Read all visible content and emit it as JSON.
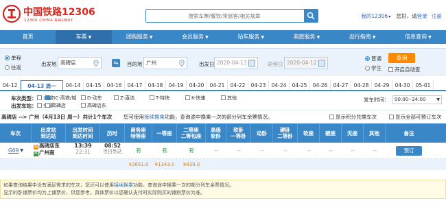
{
  "header": {
    "logo_cn": "中国铁路12306",
    "logo_en": "12306 CHINA RAILWAY",
    "search_placeholder": "搜索车票/餐饮/常旅客/相关规章",
    "my_account": "我的12306",
    "greeting": "您好，请",
    "login": "登录",
    "register": "注册"
  },
  "nav": [
    {
      "label": "首页",
      "chevron": false
    },
    {
      "label": "车票",
      "chevron": true
    },
    {
      "label": "团购服务",
      "chevron": true
    },
    {
      "label": "会员服务",
      "chevron": true
    },
    {
      "label": "站车服务",
      "chevron": true
    },
    {
      "label": "商旅服务",
      "chevron": true
    },
    {
      "label": "出行指南",
      "chevron": true
    },
    {
      "label": "信息查询",
      "chevron": true
    }
  ],
  "query": {
    "one_way": "单程",
    "round_trip": "往返",
    "from_label": "出发地",
    "from_value": "高碑店",
    "to_label": "目的地",
    "to_value": "广州",
    "depart_label": "出发日",
    "depart_value": "2020-04-13",
    "return_label": "返程日",
    "return_value": "2020-04-12",
    "search_button": "查询",
    "normal": "普通",
    "student": "学生",
    "auto_query": "开启自动查"
  },
  "dates": [
    "04-12",
    "04-13 周一",
    "04-14",
    "04-15",
    "04-16",
    "04-17",
    "04-18",
    "04-19",
    "04-20",
    "04-21",
    "04-22",
    "04-23",
    "04-24",
    "04-25",
    "04-26",
    "04-27",
    "04-28",
    "04-29",
    "04-30",
    "05-01"
  ],
  "filters": {
    "train_type_label": "车次类型：",
    "types": [
      "全部",
      "GC-高铁/城",
      "D-动车",
      "Z-直达",
      "T-特快",
      "K-快速",
      "其他"
    ],
    "station_label": "出发车站：",
    "stations": [
      "全部",
      "高碑店",
      "高碑店东"
    ],
    "depart_time_label": "发车时间：",
    "depart_time_value": "00:00--24:00"
  },
  "route": {
    "summary": "高碑店 --> 广州（4月13日 周一）共计1个车次",
    "tip_prefix": "您可使用",
    "tip_link": "接续换乘",
    "tip_suffix": "功能，查询途中换乘一次的部分列车余票情况。",
    "show_points": "显示积分兑换车次",
    "show_all": "显示全部可预订车次"
  },
  "table": {
    "headers": [
      "车次",
      "出发站\n到达站",
      "出发时间\n到达时间",
      "历时",
      "商务座\n特等座",
      "一等座",
      "二等座\n二等包座",
      "高级\n软卧",
      "软卧\n一等卧",
      "动卧",
      "硬卧\n二等卧",
      "软座",
      "硬座",
      "无座",
      "其他",
      "备注"
    ],
    "row": {
      "train": "G69",
      "from_station": "高碑店东",
      "to_station": "广州南",
      "depart_time": "13:39",
      "arrive_time": "22:31",
      "duration": "08:52",
      "arrive_day": "当日到达",
      "business": "有",
      "first": "有",
      "second": "有",
      "others": [
        "--",
        "--",
        "--",
        "--",
        "--",
        "--",
        "--",
        "--"
      ],
      "book": "预订"
    },
    "prices": [
      "¥2651.0",
      "¥1343.0",
      "¥839.0"
    ]
  },
  "notice": {
    "line1_prefix": "如果查询结果中没有满足需求的车次，您还可以使用",
    "line1_link": "接续换乘",
    "line1_suffix": "功能，查询途中换乘一次的部分列车余票情况。",
    "line2": "显示的卧铺票价均为上铺票价，供您参考。具体票价以您确认支付时实际购买的铺别票价为准。"
  },
  "colors": {
    "primary": "#3a87c8",
    "orange": "#ff8a00",
    "brand_red": "#d8261f",
    "green": "#2a9d3a"
  }
}
